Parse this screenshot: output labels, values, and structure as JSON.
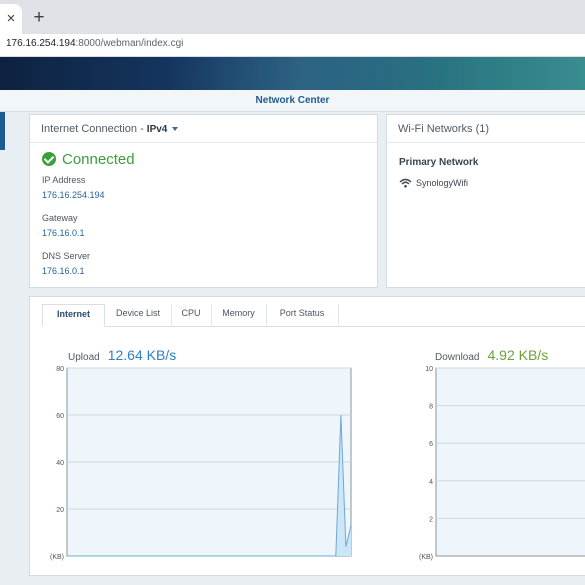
{
  "browser": {
    "close_glyph": "×",
    "new_tab_glyph": "+",
    "url_host": "176.16.254.194",
    "url_path": ":8000/webman/index.cgi"
  },
  "app": {
    "title": "Network Center"
  },
  "internet_panel": {
    "title_prefix": "Internet Connection - ",
    "protocol": "IPv4",
    "status": "Connected",
    "ip_label": "IP Address",
    "ip_value": "176.16.254.194",
    "gateway_label": "Gateway",
    "gateway_value": "176.16.0.1",
    "dns_label": "DNS Server",
    "dns_value": "176.16.0.1"
  },
  "wifi_panel": {
    "title": "Wi-Fi Networks (1)",
    "primary_label": "Primary Network",
    "network_name": "SynologyWifi"
  },
  "monitor": {
    "tabs": [
      "Internet",
      "Device List",
      "CPU",
      "Memory",
      "Port Status"
    ],
    "active_tab": "Internet",
    "upload_label": "Upload",
    "upload_value": "12.64 KB/s",
    "download_label": "Download",
    "download_value": "4.92 KB/s"
  },
  "colors": {
    "accent_blue": "#2e7fc5",
    "connected_green": "#3d9e3c",
    "download_green": "#6aa13b",
    "chart_fill": "#cde6f7",
    "chart_stroke": "#6da8d6"
  },
  "icons": {
    "status": "check-circle-icon",
    "wifi": "wifi-icon",
    "dropdown": "caret-down-icon"
  },
  "chart_data": [
    {
      "type": "area",
      "title": "Upload",
      "unit_label": "(KB)",
      "ylim": [
        0,
        80
      ],
      "y_ticks": [
        20,
        40,
        60,
        80
      ],
      "grid": true,
      "series": [
        {
          "values": [
            0,
            0,
            0,
            0,
            0,
            0,
            0,
            0,
            0,
            0,
            0,
            0,
            0,
            0,
            0,
            0,
            0,
            0,
            0,
            0,
            0,
            0,
            0,
            0,
            0,
            0,
            0,
            0,
            0,
            0,
            0,
            0,
            0,
            0,
            0,
            0,
            0,
            0,
            0,
            0,
            0,
            0,
            0,
            0,
            0,
            0,
            0,
            0,
            0,
            0,
            0,
            0,
            0,
            0,
            60,
            4,
            13
          ]
        }
      ]
    },
    {
      "type": "area",
      "title": "Download",
      "unit_label": "(KB)",
      "ylim": [
        0,
        10
      ],
      "y_ticks": [
        2,
        4,
        6,
        8,
        10
      ],
      "grid": true,
      "series": [
        {
          "values": []
        }
      ]
    }
  ]
}
